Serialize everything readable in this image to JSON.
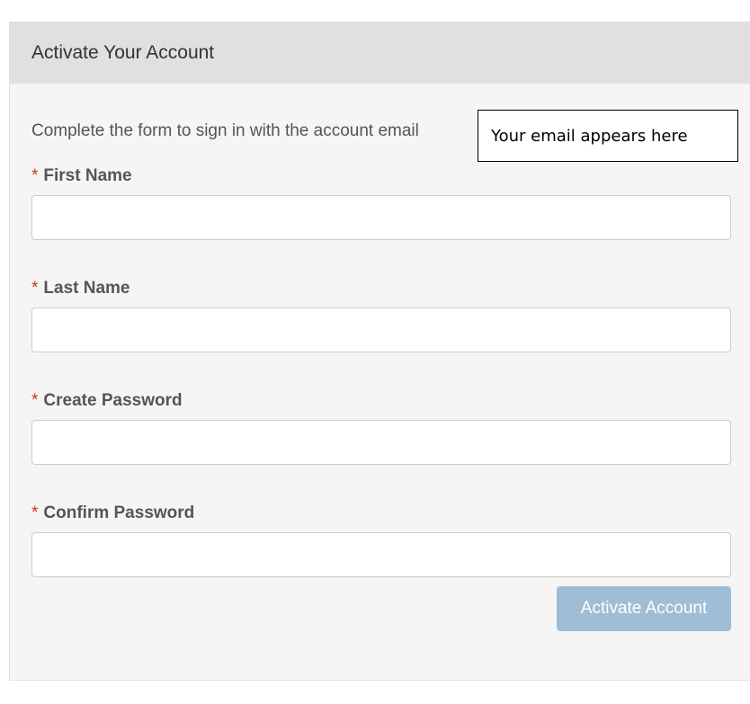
{
  "panel": {
    "title": "Activate Your Account",
    "intro_text": "Complete the form to sign in with the account email"
  },
  "callout": {
    "text": "Your email appears here"
  },
  "form": {
    "required_marker": "*",
    "fields": [
      {
        "label": "First Name",
        "value": "",
        "placeholder": ""
      },
      {
        "label": "Last Name",
        "value": "",
        "placeholder": ""
      },
      {
        "label": "Create Password",
        "value": "",
        "placeholder": ""
      },
      {
        "label": "Confirm Password",
        "value": "",
        "placeholder": ""
      }
    ],
    "submit_label": "Activate Account"
  },
  "colors": {
    "required": "#c0392b",
    "button": "#9fbed6",
    "header": "#e0e0e0"
  }
}
